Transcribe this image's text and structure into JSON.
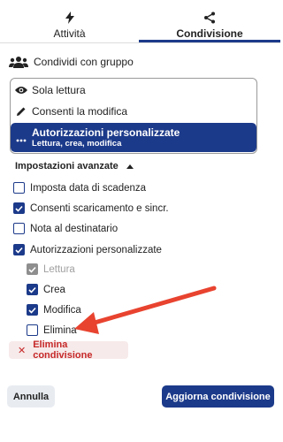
{
  "tabs": [
    {
      "label": "Attività",
      "icon": "lightning-icon",
      "active": false
    },
    {
      "label": "Condivisione",
      "icon": "share-icon",
      "active": true
    }
  ],
  "group_share": {
    "label": "Condividi con gruppo",
    "icon": "group-icon"
  },
  "permissions": {
    "read_only": {
      "label": "Sola lettura",
      "icon": "eye-icon"
    },
    "allow_edit": {
      "label": "Consenti la modifica",
      "icon": "pencil-icon"
    },
    "custom": {
      "label": "Autorizzazioni personalizzate",
      "sublabel": "Lettura, crea, modifica",
      "icon": "more-icon",
      "selected": true
    }
  },
  "advanced": {
    "title": "Impostazioni avanzate",
    "options": [
      {
        "label": "Imposta data di scadenza",
        "checked": false
      },
      {
        "label": "Consenti scaricamento e sincr.",
        "checked": true
      },
      {
        "label": "Nota al destinatario",
        "checked": false
      },
      {
        "label": "Autorizzazioni personalizzate",
        "checked": true
      }
    ],
    "custom_perms": [
      {
        "label": "Lettura",
        "checked": true,
        "disabled": true
      },
      {
        "label": "Crea",
        "checked": true,
        "disabled": false
      },
      {
        "label": "Modifica",
        "checked": true,
        "disabled": false
      },
      {
        "label": "Elimina",
        "checked": false,
        "disabled": false
      }
    ]
  },
  "delete_share": {
    "label": "Elimina condivisione"
  },
  "footer": {
    "cancel": "Annulla",
    "update": "Aggiorna condivisione"
  },
  "colors": {
    "accent": "#1c3a8a",
    "danger": "#c62828",
    "arrow": "#e8432f"
  }
}
